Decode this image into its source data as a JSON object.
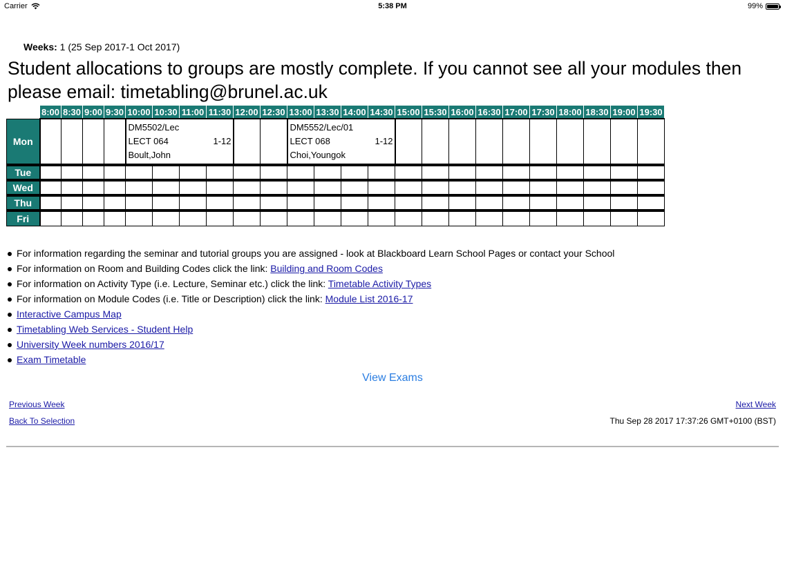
{
  "status_bar": {
    "carrier": "Carrier",
    "time": "5:38 PM",
    "battery": "99%",
    "battery_level": 0.99
  },
  "weeks": {
    "label": "Weeks:",
    "value": "1 (25 Sep 2017-1 Oct 2017)"
  },
  "headline": "Student allocations to groups are mostly complete. If you cannot see all your modules then please email: timetabling@brunel.ac.uk",
  "timetable": {
    "times": [
      "8:00",
      "8:30",
      "9:00",
      "9:30",
      "10:00",
      "10:30",
      "11:00",
      "11:30",
      "12:00",
      "12:30",
      "13:00",
      "13:30",
      "14:00",
      "14:30",
      "15:00",
      "15:30",
      "16:00",
      "16:30",
      "17:00",
      "17:30",
      "18:00",
      "18:30",
      "19:00",
      "19:30"
    ],
    "days": [
      "Mon",
      "Tue",
      "Wed",
      "Thu",
      "Fri"
    ],
    "events": [
      {
        "code": "DM5502/Lec",
        "room": "LECT 064",
        "weeks": "1-12",
        "staff": "Boult,John"
      },
      {
        "code": "DM5552/Lec/01",
        "room": "LECT 068",
        "weeks": "1-12",
        "staff": "Choi,Youngok"
      }
    ]
  },
  "info": [
    {
      "text": "For information regarding the seminar and tutorial groups you are assigned - look at Blackboard Learn School Pages or contact your School",
      "link": ""
    },
    {
      "text": "For information on Room and Building Codes click the link: ",
      "link": "Building and Room Codes"
    },
    {
      "text": "For information on Activity Type (i.e. Lecture, Seminar etc.) click the link: ",
      "link": "Timetable Activity Types"
    },
    {
      "text": "For information on Module Codes (i.e. Title or Description) click the link: ",
      "link": "Module List 2016-17"
    },
    {
      "text": "",
      "link": "Interactive Campus Map"
    },
    {
      "text": "",
      "link": "Timetabling Web Services - Student Help"
    },
    {
      "text": "",
      "link": "University Week numbers 2016/17"
    },
    {
      "text": "",
      "link": "Exam Timetable"
    }
  ],
  "view_exams": "View Exams",
  "nav": {
    "previous": "Previous Week",
    "next": "Next Week",
    "back": "Back To Selection",
    "timestamp": "Thu Sep 28 2017 17:37:26 GMT+0100 (BST)"
  },
  "colors": {
    "header_teal": "#1a7a74",
    "link": "#1a1aa6",
    "view_exams": "#2a7de1"
  },
  "icons": {
    "wifi": "wifi-icon",
    "battery": "battery-icon"
  }
}
